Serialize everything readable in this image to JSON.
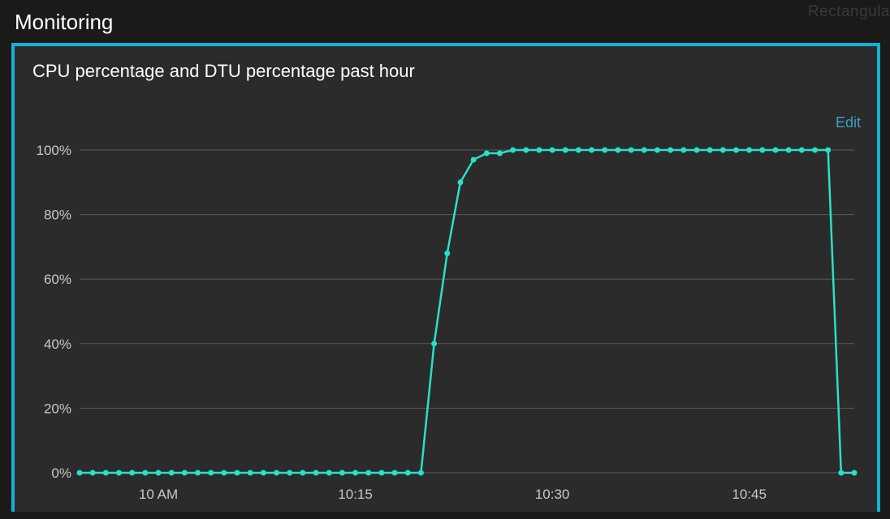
{
  "header": {
    "title": "Monitoring",
    "snip_fragment": "Rectangula"
  },
  "card": {
    "title": "CPU percentage and DTU percentage past hour",
    "edit_label": "Edit"
  },
  "chart_data": {
    "type": "line",
    "title": "CPU percentage and DTU percentage past hour",
    "xlabel": "",
    "ylabel": "",
    "ylim": [
      0,
      100
    ],
    "y_ticks": [
      0,
      20,
      40,
      60,
      80,
      100
    ],
    "y_tick_labels": [
      "0%",
      "20%",
      "40%",
      "60%",
      "80%",
      "100%"
    ],
    "x_tick_labels": [
      "10 AM",
      "10:15",
      "10:30",
      "10:45"
    ],
    "x_tick_positions": [
      6,
      21,
      36,
      51
    ],
    "categories_minutes_after_9_54": [
      0,
      1,
      2,
      3,
      4,
      5,
      6,
      7,
      8,
      9,
      10,
      11,
      12,
      13,
      14,
      15,
      16,
      17,
      18,
      19,
      20,
      21,
      22,
      23,
      24,
      25,
      26,
      27,
      28,
      29,
      30,
      31,
      32,
      33,
      34,
      35,
      36,
      37,
      38,
      39,
      40,
      41,
      42,
      43,
      44,
      45,
      46,
      47,
      48,
      49,
      50,
      51,
      52,
      53,
      54,
      55,
      56,
      57,
      58,
      59
    ],
    "series": [
      {
        "name": "CPU percentage",
        "color": "#29e0c9",
        "values": [
          0,
          0,
          0,
          0,
          0,
          0,
          0,
          0,
          0,
          0,
          0,
          0,
          0,
          0,
          0,
          0,
          0,
          0,
          0,
          0,
          0,
          0,
          0,
          0,
          0,
          0,
          0,
          40,
          68,
          90,
          97,
          99,
          99,
          100,
          100,
          100,
          100,
          100,
          100,
          100,
          100,
          100,
          100,
          100,
          100,
          100,
          100,
          100,
          100,
          100,
          100,
          100,
          100,
          100,
          100,
          100,
          100,
          100,
          0,
          0
        ]
      }
    ]
  }
}
